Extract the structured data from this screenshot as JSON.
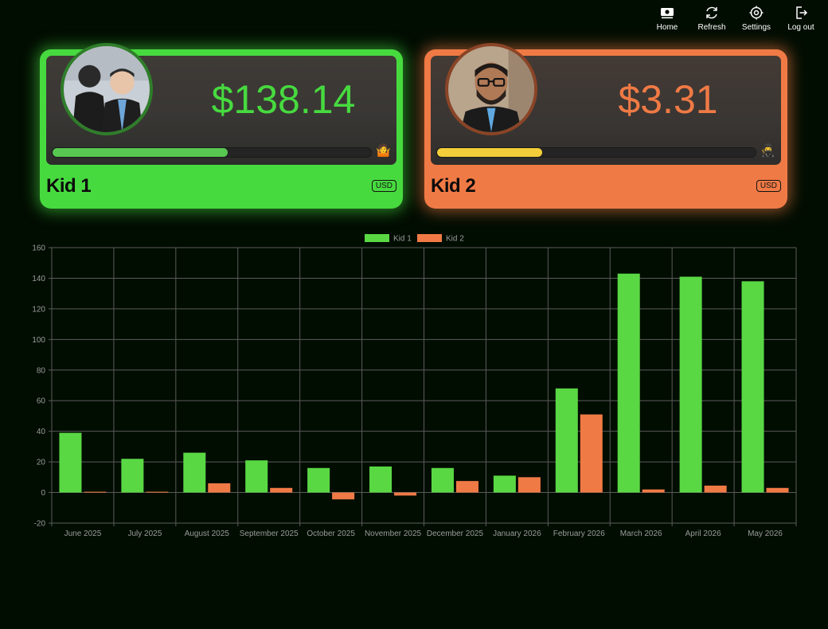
{
  "nav": {
    "home": "Home",
    "refresh": "Refresh",
    "settings": "Settings",
    "logout": "Log out"
  },
  "kids": [
    {
      "name": "Kid 1",
      "balance": "$138.14",
      "currency": "USD",
      "progress": 0.55,
      "goal_icon": "person-shrugging-icon",
      "color": "#47da3f"
    },
    {
      "name": "Kid 2",
      "balance": "$3.31",
      "currency": "USD",
      "progress": 0.33,
      "goal_icon": "ninja-icon",
      "color": "#f07a45"
    }
  ],
  "chart_data": {
    "type": "bar",
    "categories": [
      "June 2025",
      "July 2025",
      "August 2025",
      "September 2025",
      "October 2025",
      "November 2025",
      "December 2025",
      "January 2026",
      "February 2026",
      "March 2026",
      "April 2026",
      "May 2026"
    ],
    "series": [
      {
        "name": "Kid 1",
        "color": "#5ad844",
        "values": [
          39,
          22,
          26,
          21,
          16,
          17,
          16,
          11,
          68,
          143,
          141,
          138
        ]
      },
      {
        "name": "Kid 2",
        "color": "#f07a45",
        "values": [
          0.5,
          0.5,
          6,
          3,
          -4.5,
          -2,
          7.5,
          10,
          51,
          2,
          4.5,
          3
        ]
      }
    ],
    "ylim": [
      -20,
      160
    ],
    "yticks": [
      -20,
      0,
      20,
      40,
      60,
      80,
      100,
      120,
      140,
      160
    ],
    "legend": "top-center",
    "grid": true
  }
}
